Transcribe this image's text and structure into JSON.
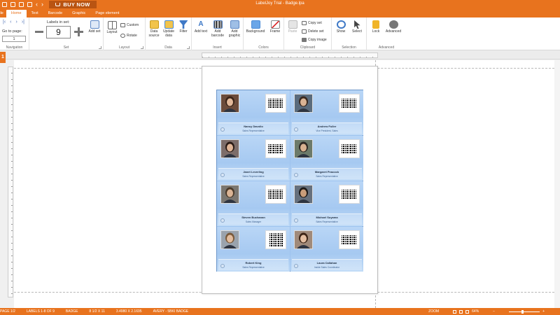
{
  "app": {
    "title": "LabelJoy Trial - Badge.lpa",
    "buy_now": "BUY NOW"
  },
  "tabs": [
    {
      "label": "File"
    },
    {
      "label": "Home"
    },
    {
      "label": "Text"
    },
    {
      "label": "Barcode"
    },
    {
      "label": "Graphic"
    },
    {
      "label": "Page element"
    }
  ],
  "ribbon": {
    "navigation": {
      "label": "Navigation",
      "goto_label": "Go to page:",
      "page_value": "1"
    },
    "set": {
      "label": "Set",
      "labels_in_set_label": "Labels in set:",
      "labels_in_set_value": "9",
      "add_set": "Add set"
    },
    "layout": {
      "label": "Layout",
      "layout_btn": "Layout",
      "custom": "Custom",
      "rotate": "Rotate"
    },
    "data": {
      "label": "Data",
      "data_source": "Data source",
      "update_data": "Update data",
      "filter": "Filter"
    },
    "insert": {
      "label": "Insert",
      "add_text": "Add text",
      "add_barcode": "Add barcode",
      "add_graphic": "Add graphic"
    },
    "colors": {
      "label": "Colors",
      "background": "Background",
      "frame": "Frame"
    },
    "clipboard": {
      "label": "Clipboard",
      "paste": "Paste",
      "copy_set": "Copy set",
      "delete_set": "Delete set",
      "copy_image": "Copy image"
    },
    "selection": {
      "label": "Selection",
      "show": "Show",
      "select": "Select"
    },
    "advanced": {
      "label": "Advanced",
      "lock": "Lock",
      "advanced": "Advanced"
    }
  },
  "ruler": {
    "corner": "1"
  },
  "badges": [
    {
      "name": "Nancy Davolio",
      "title": "Sales Representative",
      "photo": "woman-1",
      "code": "barcode"
    },
    {
      "name": "Andrew Fuller",
      "title": "Vice President, Sales",
      "photo": "man-1",
      "code": "barcode"
    },
    {
      "name": "Janet Leverling",
      "title": "Sales Representative",
      "photo": "woman-2",
      "code": "barcode"
    },
    {
      "name": "Margaret Peacock",
      "title": "Sales Representative",
      "photo": "man-2",
      "code": "barcode"
    },
    {
      "name": "Steven Buchanan",
      "title": "Sales Manager",
      "photo": "man-3",
      "code": "barcode"
    },
    {
      "name": "Michael Suyama",
      "title": "Sales Representative",
      "photo": "man-4",
      "code": "barcode"
    },
    {
      "name": "Robert King",
      "title": "Sales Representative",
      "photo": "man-5",
      "code": "qrcode"
    },
    {
      "name": "Laura Callahan",
      "title": "Inside Sales Coordinator",
      "photo": "woman-3",
      "code": "barcode"
    }
  ],
  "status": {
    "page": "PAGE 1/2",
    "labels": "LABELS 1-8 OF 9",
    "set_name": "BADGE",
    "paper": "8 1/2 X 11",
    "size": "3.4980 X 2.1695",
    "template": "AVERY - 5BKI BADGE",
    "zoom_label": "ZOOM",
    "zoom_value": "64%"
  },
  "colors": {
    "accent": "#e8731e",
    "label_blue": "#a6c9f1"
  }
}
